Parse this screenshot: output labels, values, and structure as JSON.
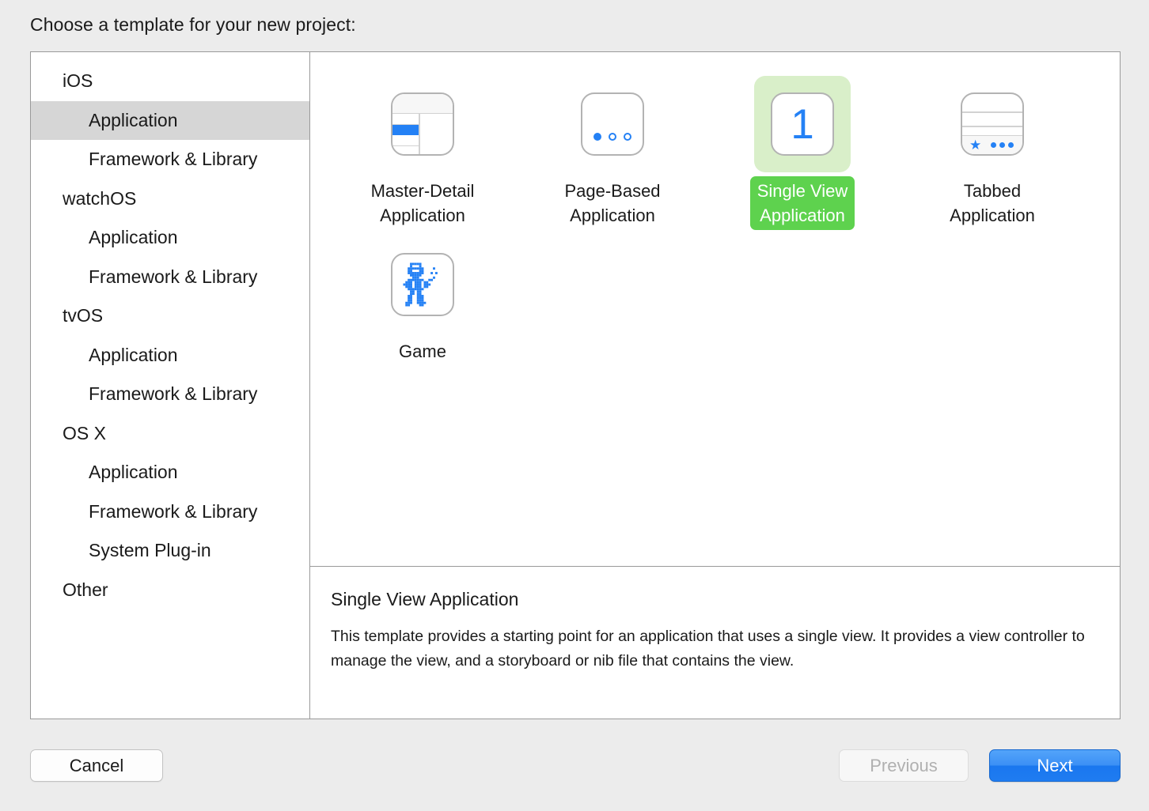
{
  "header": {
    "prompt": "Choose a template for your new project:"
  },
  "sidebar": {
    "items": [
      {
        "label": "iOS",
        "level": "group",
        "selected": false
      },
      {
        "label": "Application",
        "level": "child",
        "selected": true
      },
      {
        "label": "Framework & Library",
        "level": "child",
        "selected": false
      },
      {
        "label": "watchOS",
        "level": "group",
        "selected": false
      },
      {
        "label": "Application",
        "level": "child",
        "selected": false
      },
      {
        "label": "Framework & Library",
        "level": "child",
        "selected": false
      },
      {
        "label": "tvOS",
        "level": "group",
        "selected": false
      },
      {
        "label": "Application",
        "level": "child",
        "selected": false
      },
      {
        "label": "Framework & Library",
        "level": "child",
        "selected": false
      },
      {
        "label": "OS X",
        "level": "group",
        "selected": false
      },
      {
        "label": "Application",
        "level": "child",
        "selected": false
      },
      {
        "label": "Framework & Library",
        "level": "child",
        "selected": false
      },
      {
        "label": "System Plug-in",
        "level": "child",
        "selected": false
      },
      {
        "label": "Other",
        "level": "group",
        "selected": false
      }
    ]
  },
  "templates": [
    {
      "label": "Master-Detail\nApplication",
      "icon": "master-detail-icon",
      "selected": false
    },
    {
      "label": "Page-Based\nApplication",
      "icon": "page-based-icon",
      "selected": false
    },
    {
      "label": "Single View\nApplication",
      "icon": "single-view-icon",
      "glyph": "1",
      "selected": true
    },
    {
      "label": "Tabbed\nApplication",
      "icon": "tabbed-icon",
      "selected": false
    },
    {
      "label": "Game",
      "icon": "game-robot-icon",
      "selected": false
    }
  ],
  "description": {
    "title": "Single View Application",
    "body": "This template provides a starting point for an application that uses a single view. It provides a view controller to manage the view, and a storyboard or nib file that contains the view."
  },
  "footer": {
    "cancel_label": "Cancel",
    "previous_label": "Previous",
    "next_label": "Next"
  },
  "colors": {
    "accent_blue": "#2481f5",
    "selection_green": "#5ed24e",
    "selection_green_light": "#d9efc9",
    "sidebar_selection": "#d6d6d6",
    "next_button_blue": "#2b83f2"
  }
}
